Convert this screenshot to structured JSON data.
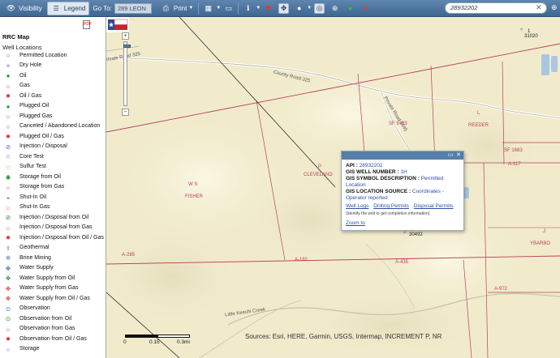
{
  "toolbar": {
    "visibility_label": "Visibility",
    "legend_label": "Legend",
    "goto_label": "Go To:",
    "goto_value": "289 LEON",
    "print_label": "Print",
    "search_value": "28932202"
  },
  "sidebar": {
    "title": "RRC Map",
    "subtitle": "Well Locations",
    "items": [
      {
        "label": "Permitted Location",
        "symbol": "○",
        "color": "#4a5fb0"
      },
      {
        "label": "Dry Hole",
        "symbol": "✧",
        "color": "#4a5fb0"
      },
      {
        "label": "Oil",
        "symbol": "●",
        "color": "#1d8a2e"
      },
      {
        "label": "Gas",
        "symbol": "☼",
        "color": "#d9373a"
      },
      {
        "label": "Oil / Gas",
        "symbol": "✹",
        "color": "#d9373a"
      },
      {
        "label": "Plugged Oil",
        "symbol": "●",
        "color": "#1d8a2e"
      },
      {
        "label": "Plugged Gas",
        "symbol": "☼",
        "color": "#d9373a"
      },
      {
        "label": "Canceled / Abandoned Location",
        "symbol": "○",
        "color": "#4a5fb0"
      },
      {
        "label": "Plugged Oil / Gas",
        "symbol": "✹",
        "color": "#d9373a"
      },
      {
        "label": "Injection / Disposal",
        "symbol": "⊘",
        "color": "#4a5fb0"
      },
      {
        "label": "Core Test",
        "symbol": "☆",
        "color": "#4a5fb0"
      },
      {
        "label": "Sulfur Test",
        "symbol": "☆",
        "color": "#d9a020"
      },
      {
        "label": "Storage from Oil",
        "symbol": "◉",
        "color": "#1d8a2e"
      },
      {
        "label": "Storage from Gas",
        "symbol": "☼",
        "color": "#d9373a"
      },
      {
        "label": "Shut-In Oil",
        "symbol": "◒",
        "color": "#1d8a2e"
      },
      {
        "label": "Shut-In Gas",
        "symbol": "☼",
        "color": "#d9373a"
      },
      {
        "label": "Injection / Disposal from Oil",
        "symbol": "⊘",
        "color": "#1d8a2e"
      },
      {
        "label": "Injection / Disposal from Gas",
        "symbol": "☼",
        "color": "#d9373a"
      },
      {
        "label": "Injection / Disposal from Oil / Gas",
        "symbol": "✹",
        "color": "#d9373a"
      },
      {
        "label": "Geothermal",
        "symbol": "⇧",
        "color": "#4a5fb0"
      },
      {
        "label": "Brine Mining",
        "symbol": "✲",
        "color": "#4a5fb0"
      },
      {
        "label": "Water Supply",
        "symbol": "✥",
        "color": "#4a5fb0"
      },
      {
        "label": "Water Supply from Oil",
        "symbol": "✥",
        "color": "#1d8a2e"
      },
      {
        "label": "Water Supply from Gas",
        "symbol": "✥",
        "color": "#d9373a"
      },
      {
        "label": "Water Supply from Oil / Gas",
        "symbol": "✥",
        "color": "#d9373a"
      },
      {
        "label": "Observation",
        "symbol": "⊙",
        "color": "#4a5fb0"
      },
      {
        "label": "Observation from Oil",
        "symbol": "⊙",
        "color": "#1d8a2e"
      },
      {
        "label": "Observation from Gas",
        "symbol": "☼",
        "color": "#d9373a"
      },
      {
        "label": "Observation from Oil / Gas",
        "symbol": "✹",
        "color": "#d9373a"
      },
      {
        "label": "Storage",
        "symbol": "○",
        "color": "#4a5fb0"
      }
    ]
  },
  "map": {
    "labels": {
      "road_ccw": "County Road 325",
      "road_pr": "Private Road 3445",
      "road_top_left": "Private Road 325",
      "creek": "Little Keechi Creek",
      "ws": "W S",
      "fisher": "FISHER",
      "p": "P",
      "cleveland": "CLEVELAND",
      "sf9783": "SF 9783",
      "l": "L",
      "reeder": "REEDER",
      "sf1683": "SF 1683",
      "a117": "A-117",
      "j": "J",
      "ybarbo": "YBARBO",
      "a972": "A-972",
      "a285": "A-285",
      "a182": "A-182",
      "a435": "A-435",
      "n30492": "30492",
      "n1": "1",
      "n31020": "31020"
    },
    "popup": {
      "api_label": "API :",
      "api_value": "28932202",
      "well_label": "GIS WELL NUMBER :",
      "well_value": "1H",
      "symbol_label": "GIS SYMBOL DESCRIPTION :",
      "symbol_value": "Permitted Location",
      "source_label": "GIS LOCATION SOURCE :",
      "source_value": "Coordinates - Operator reported",
      "link_logs": "Well Logs",
      "link_drilling": "Drilling Permits",
      "link_disposal": "Disposal Permits",
      "note": "(Identify the well to get completion information)",
      "zoom_to": "Zoom to"
    },
    "scale": {
      "t0": "0",
      "t1": "0.15",
      "t2": "0.3mi"
    },
    "attribution": "Sources: Esri, HERE, Garmin, USGS, Intermap, INCREMENT P, NR"
  },
  "colors": {
    "toolbar": "#4a73a0",
    "survey_line": "#b8415a",
    "map_bg": "#f1ebcc",
    "popup_header": "#557ea8",
    "marker": "#3bc0e8"
  }
}
